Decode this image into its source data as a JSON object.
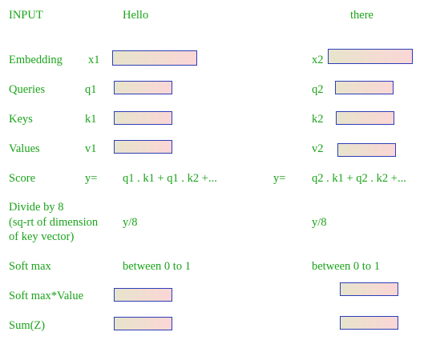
{
  "colors": {
    "text": "#1aa31a",
    "box_border": "#2b3eb8",
    "box_fill_left": "#e7e4cb",
    "box_fill_right": "#fbd6d6"
  },
  "header": {
    "label": "INPUT",
    "word1": "Hello",
    "word2": "there"
  },
  "rows": {
    "embedding": {
      "label": "Embedding",
      "var1": "x1",
      "var2": "x2"
    },
    "queries": {
      "label": "Queries",
      "var1": "q1",
      "var2": "q2"
    },
    "keys": {
      "label": "Keys",
      "var1": "k1",
      "var2": "k2"
    },
    "values": {
      "label": "Values",
      "var1": "v1",
      "var2": "v2"
    },
    "score": {
      "label": "Score",
      "eq1": "y=",
      "expr1": "q1 . k1 + q1 . k2 +...",
      "eq2": "y=",
      "expr2": "q2 . k1 + q2 . k2 +..."
    },
    "divide": {
      "label": "Divide by 8\n(sq-rt of dimension\nof key vector)",
      "expr1": "y/8",
      "expr2": "y/8"
    },
    "softmax": {
      "label": "Soft max",
      "range1": "between 0 to 1",
      "range2": "between 0 to 1"
    },
    "softmax_value": {
      "label": "Soft max*Value"
    },
    "sum": {
      "label": "Sum(Z)"
    }
  }
}
